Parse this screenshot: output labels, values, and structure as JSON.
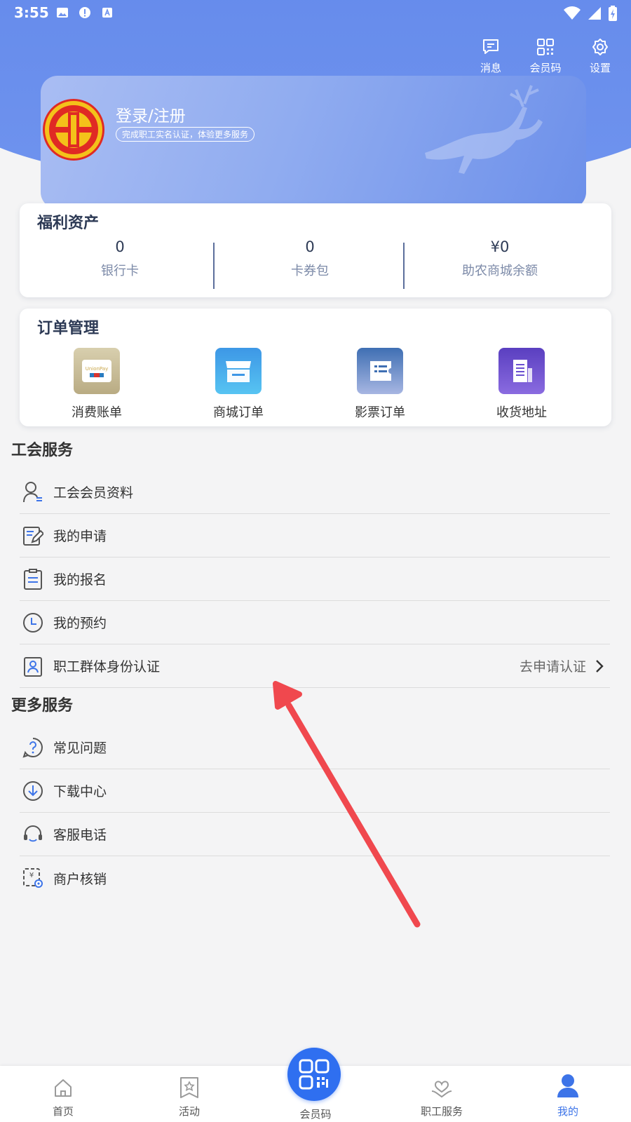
{
  "status_bar": {
    "time": "3:55"
  },
  "top_actions": [
    {
      "label": "消息",
      "icon": "message-icon"
    },
    {
      "label": "会员码",
      "icon": "qr-code-icon"
    },
    {
      "label": "设置",
      "icon": "gear-icon"
    }
  ],
  "profile": {
    "title": "登录/注册",
    "hint": "完成职工实名认证，体验更多服务"
  },
  "assets": {
    "title": "福利资产",
    "items": [
      {
        "value": "0",
        "label": "银行卡"
      },
      {
        "value": "0",
        "label": "卡券包"
      },
      {
        "value": "¥0",
        "label": "助农商城余额"
      }
    ]
  },
  "orders": {
    "title": "订单管理",
    "items": [
      {
        "label": "消费账单",
        "icon": "unionpay-bill-icon"
      },
      {
        "label": "商城订单",
        "icon": "store-icon"
      },
      {
        "label": "影票订单",
        "icon": "ticket-icon"
      },
      {
        "label": "收货地址",
        "icon": "building-icon"
      }
    ]
  },
  "union_services": {
    "title": "工会服务",
    "items": [
      {
        "label": "工会会员资料",
        "icon": "member-profile-icon"
      },
      {
        "label": "我的申请",
        "icon": "edit-form-icon"
      },
      {
        "label": "我的报名",
        "icon": "clipboard-icon"
      },
      {
        "label": "我的预约",
        "icon": "clock-icon"
      },
      {
        "label": "职工群体身份认证",
        "icon": "id-badge-icon",
        "right_text": "去申请认证"
      }
    ]
  },
  "more_services": {
    "title": "更多服务",
    "items": [
      {
        "label": "常见问题",
        "icon": "question-icon"
      },
      {
        "label": "下载中心",
        "icon": "download-icon"
      },
      {
        "label": "客服电话",
        "icon": "headset-icon"
      },
      {
        "label": "商户核销",
        "icon": "merchant-verify-icon"
      }
    ]
  },
  "tabbar": {
    "items": [
      {
        "label": "首页",
        "icon": "home-icon"
      },
      {
        "label": "活动",
        "icon": "star-badge-icon"
      },
      {
        "label": "会员码",
        "icon": "qr-code-icon"
      },
      {
        "label": "职工服务",
        "icon": "heart-hand-icon"
      },
      {
        "label": "我的",
        "icon": "user-icon"
      }
    ],
    "active": "我的"
  },
  "colors": {
    "header_blue": "#5f86ea",
    "accent_blue": "#2f6ff0",
    "active_tab": "#3d74e8",
    "annotation_arrow": "#f0484e"
  }
}
